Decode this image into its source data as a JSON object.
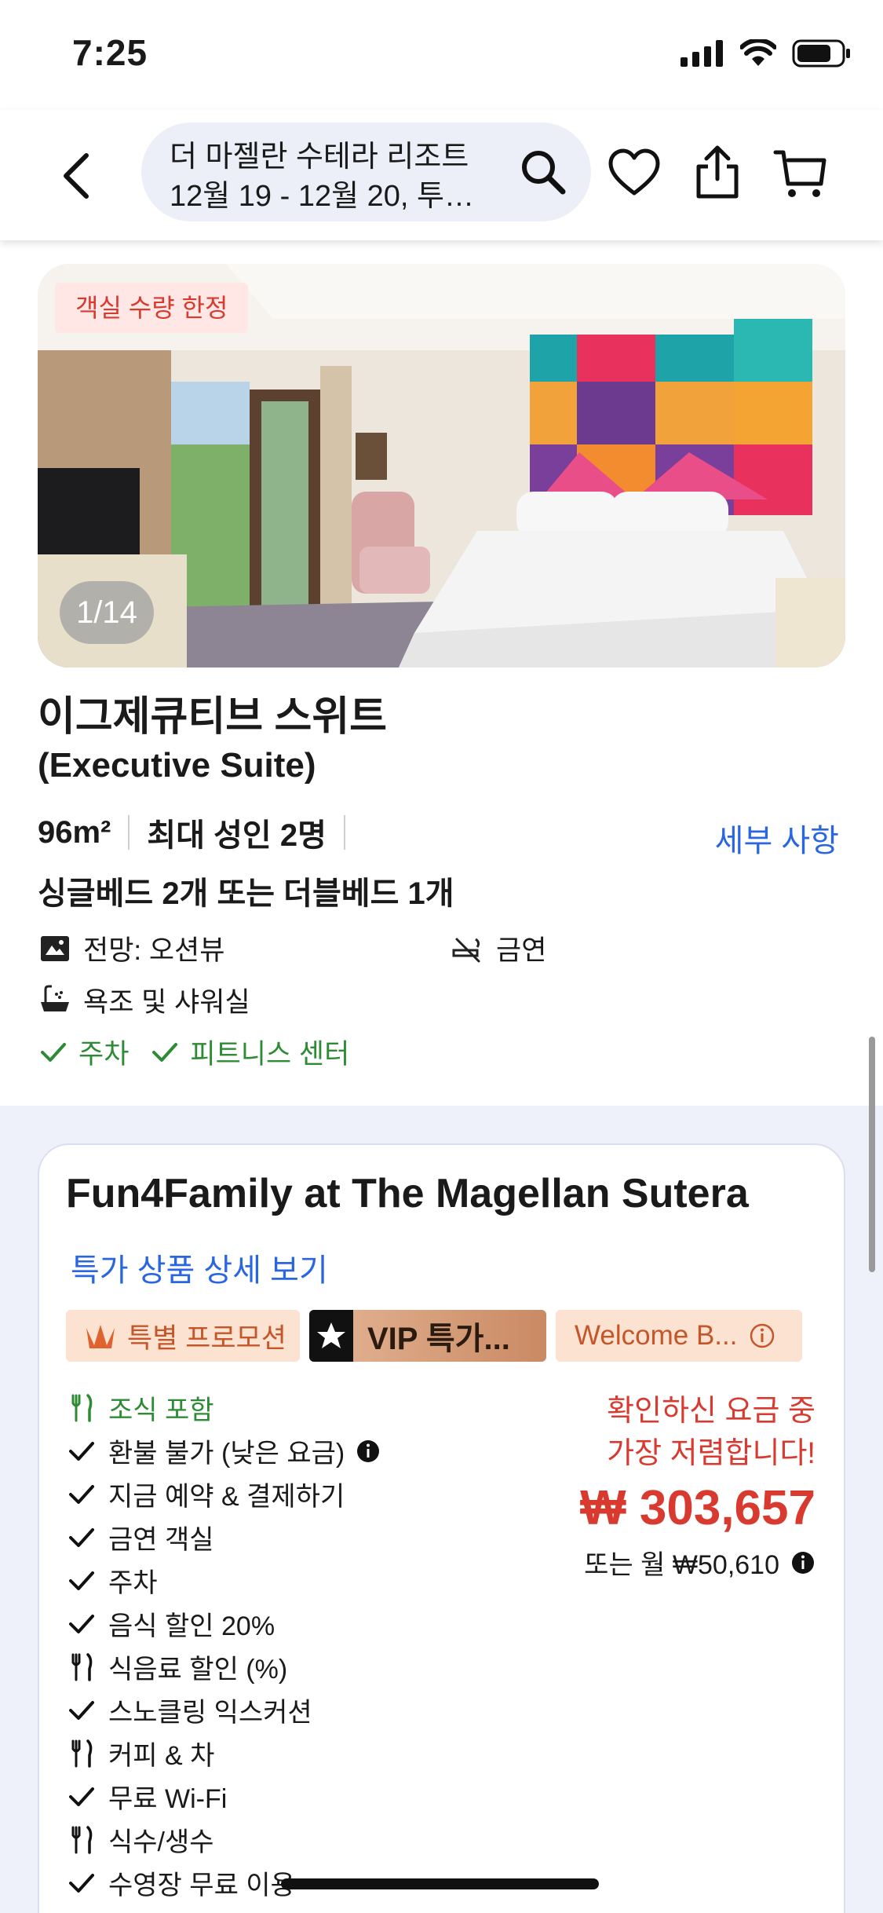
{
  "status_bar": {
    "time": "7:25"
  },
  "header": {
    "search_title": "더 마젤란 수테라 리조트",
    "search_subtitle": "12월 19 - 12월 20, 투…"
  },
  "room": {
    "limited_badge": "객실 수량 한정",
    "photo_counter": "1/14",
    "title": "이그제큐티브 스위트",
    "subtitle": "(Executive Suite)",
    "size": "96m²",
    "capacity": "최대 성인 2명",
    "details_link": "세부 사항",
    "beds": "싱글베드 2개 또는 더블베드 1개",
    "amenities": [
      {
        "icon": "view-icon",
        "label": "전망: 오션뷰"
      },
      {
        "icon": "no-smoking-icon",
        "label": "금연"
      },
      {
        "icon": "bath-icon",
        "label": "욕조 및 샤워실"
      }
    ],
    "included": [
      {
        "icon": "check-icon",
        "label": "주차"
      },
      {
        "icon": "check-icon",
        "label": "피트니스 센터"
      }
    ]
  },
  "deal": {
    "title": "Fun4Family at The Magellan Sutera",
    "details_link": "특가 상품 상세 보기",
    "chips": {
      "promo": "특별 프로모션",
      "vip": "VIP 특가...",
      "welcome": "Welcome B..."
    },
    "features": [
      {
        "icon": "utensils-icon",
        "label": "조식 포함",
        "green": true
      },
      {
        "icon": "check-icon",
        "label": "환불 불가 (낮은 요금)",
        "info": true
      },
      {
        "icon": "check-icon",
        "label": "지금 예약 & 결제하기"
      },
      {
        "icon": "check-icon",
        "label": "금연 객실"
      },
      {
        "icon": "check-icon",
        "label": "주차"
      },
      {
        "icon": "check-icon",
        "label": "음식 할인 20%"
      },
      {
        "icon": "utensils-icon",
        "label": "식음료 할인 (%)"
      },
      {
        "icon": "check-icon",
        "label": "스노클링 익스커션"
      },
      {
        "icon": "utensils-icon",
        "label": "커피 & 차"
      },
      {
        "icon": "check-icon",
        "label": "무료 Wi-Fi"
      },
      {
        "icon": "utensils-icon",
        "label": "식수/생수"
      },
      {
        "icon": "check-icon",
        "label": "수영장 무료 이용"
      }
    ],
    "cheapest_line1": "확인하신 요금 중",
    "cheapest_line2": "가장 저렴합니다!",
    "price": "₩ 303,657",
    "monthly": "또는 월 ₩50,610"
  },
  "colors": {
    "accent_blue": "#2a66e0",
    "price_red": "#d83a30",
    "included_green": "#2e8b35"
  }
}
